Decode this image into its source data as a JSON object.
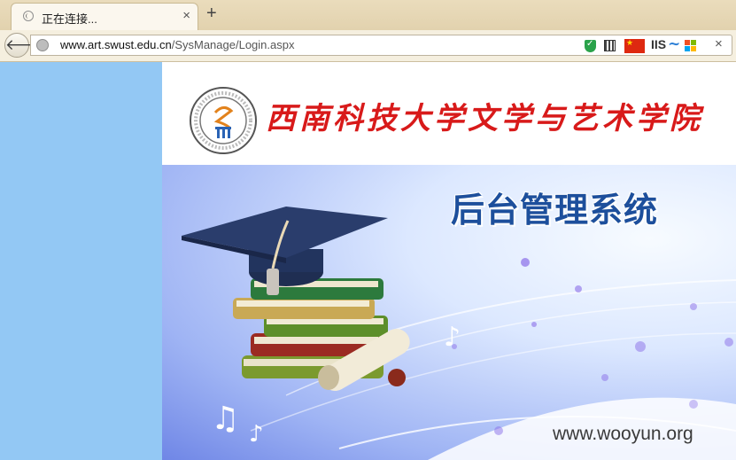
{
  "browser": {
    "tab_title": "正在连接...",
    "tab_close": "×",
    "new_tab": "+",
    "url_host": "www.art.swust.edu.cn",
    "url_path": "/SysManage/Login.aspx",
    "iis_label": "IIS",
    "stop_label": "×",
    "back_label": "🡐"
  },
  "page": {
    "school_name": "西南科技大学文学与艺术学院",
    "system_title": "后台管理系统",
    "watermark": "www.wooyun.org"
  },
  "colors": {
    "sidebar": "#93c8f4",
    "school_name": "#d81a1a",
    "system_title": "#1d4f9c"
  }
}
